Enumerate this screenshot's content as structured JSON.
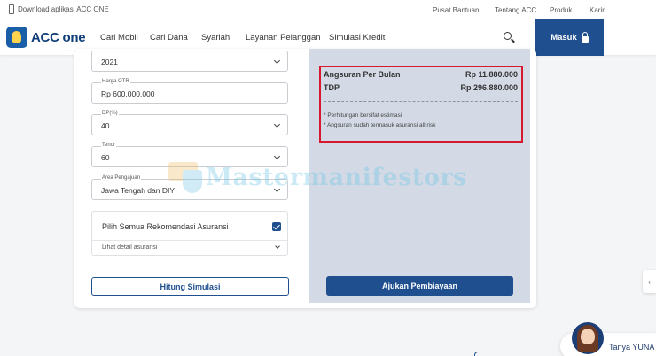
{
  "topbar": {
    "download_text": "Download aplikasi ACC ONE",
    "links": [
      "Pusat Bantuan",
      "Tentang ACC",
      "Produk",
      "Karir"
    ]
  },
  "nav": {
    "logo_text": "ACC one",
    "menu": [
      "Cari Mobil",
      "Cari Dana",
      "Syariah",
      "Layanan Pelanggan",
      "Simulasi Kredit"
    ],
    "login_label": "Masuk"
  },
  "form": {
    "year": {
      "value": "2021"
    },
    "price": {
      "label": "Harga OTR",
      "value": "Rp 600,000,000"
    },
    "dp": {
      "label": "DP(%)",
      "value": "40"
    },
    "tenor": {
      "label": "Tenor",
      "value": "60"
    },
    "area": {
      "label": "Area Pengajuan",
      "value": "Jawa Tengah dan DIY"
    },
    "insurance": {
      "title": "Pilih Semua Rekomendasi Asuransi",
      "checked": true,
      "detail": "Lihat detail asuransi"
    },
    "simulate_button": "Hitung Simulasi"
  },
  "result": {
    "monthly_label": "Angsuran Per Bulan",
    "monthly_value": "Rp 11.880.000",
    "tdp_label": "TDP",
    "tdp_value": "Rp 296.880.000",
    "notes": [
      "* Perhitungan bersifat estimasi",
      "* Angsuran sudah termasuk asuransi all risk"
    ],
    "apply_button": "Ajukan Pembiayaan"
  },
  "watermark": {
    "text": "Mastermanifestors"
  },
  "chat": {
    "label": "Tanya YUNA ›"
  },
  "side_tab": {
    "label": "‹"
  },
  "colors": {
    "primary": "#1f4f8f",
    "highlight": "#d6192e",
    "panel": "#d3dae5"
  }
}
